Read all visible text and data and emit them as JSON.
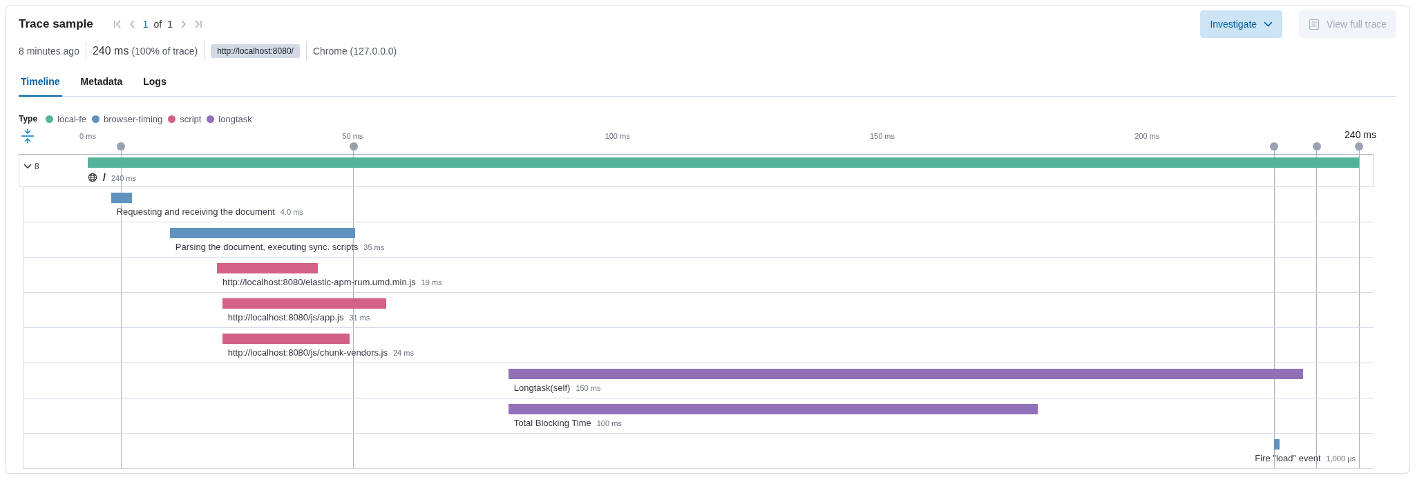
{
  "header": {
    "title": "Trace sample",
    "pagination": {
      "current": "1",
      "of": "of",
      "total": "1"
    },
    "buttons": [
      {
        "label": "Investigate",
        "kind": "menu",
        "disabled": false
      },
      {
        "label": "View full trace",
        "kind": "icon",
        "disabled": true
      }
    ]
  },
  "summary": {
    "age": "8 minutes ago",
    "duration": "240 ms",
    "share": "(100% of trace)",
    "url": "http://localhost:8080/",
    "agent": "Chrome (127.0.0.0)"
  },
  "tabs": [
    {
      "label": "Timeline",
      "selected": true
    },
    {
      "label": "Metadata",
      "selected": false
    },
    {
      "label": "Logs",
      "selected": false
    }
  ],
  "legend": {
    "title": "Type",
    "items": [
      {
        "label": "local-fe",
        "color": "#54b399"
      },
      {
        "label": "browser-timing",
        "color": "#6092c0"
      },
      {
        "label": "script",
        "color": "#d36086"
      },
      {
        "label": "longtask",
        "color": "#9170b8"
      }
    ]
  },
  "timeline": {
    "end_label": "240 ms",
    "ticks": [
      "0 ms",
      "50 ms",
      "100 ms",
      "150 ms",
      "200 ms"
    ],
    "root": {
      "expanded": true,
      "child_count": "8",
      "name": "/",
      "duration": "240 ms",
      "color": "#54b399"
    },
    "spans": [
      {
        "name": "Requesting and receiving the document",
        "duration": "4.0 ms",
        "color": "#6092c0"
      },
      {
        "name": "Parsing the document, executing sync. scripts",
        "duration": "35 ms",
        "color": "#6092c0"
      },
      {
        "name": "http://localhost:8080/elastic-apm-rum.umd.min.js",
        "duration": "19 ms",
        "color": "#d36086"
      },
      {
        "name": "http://localhost:8080/js/app.js",
        "duration": "31 ms",
        "color": "#d36086"
      },
      {
        "name": "http://localhost:8080/js/chunk-vendors.js",
        "duration": "24 ms",
        "color": "#d36086"
      },
      {
        "name": "Longtask(self)",
        "duration": "150 ms",
        "color": "#9170b8"
      },
      {
        "name": "Total Blocking Time",
        "duration": "100 ms",
        "color": "#9170b8"
      },
      {
        "name": "Fire \"load\" event",
        "duration": "1,000 μs",
        "color": "#6092c0"
      }
    ]
  }
}
